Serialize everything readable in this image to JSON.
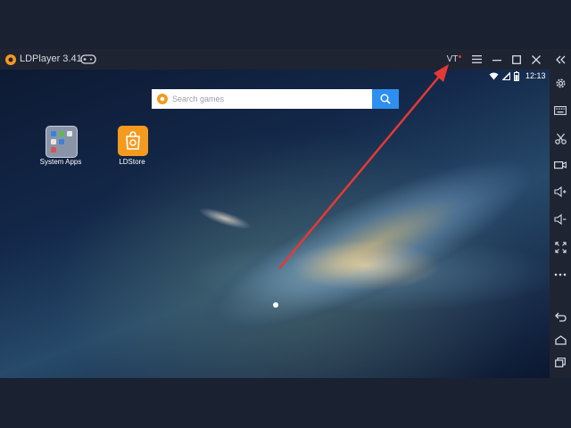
{
  "window": {
    "title": "LDPlayer 3.41",
    "vt_label": "VT"
  },
  "search": {
    "placeholder": "Search games"
  },
  "apps": [
    {
      "label": "System Apps"
    },
    {
      "label": "LDStore"
    }
  ],
  "status_bar": {
    "time": "12:13"
  },
  "colors": {
    "titlebar": "#1f2432",
    "search_button": "#2e8ff0",
    "ldstore": "#f39a1f",
    "arrow": "#e53935",
    "vt_dot": "#e53935"
  }
}
